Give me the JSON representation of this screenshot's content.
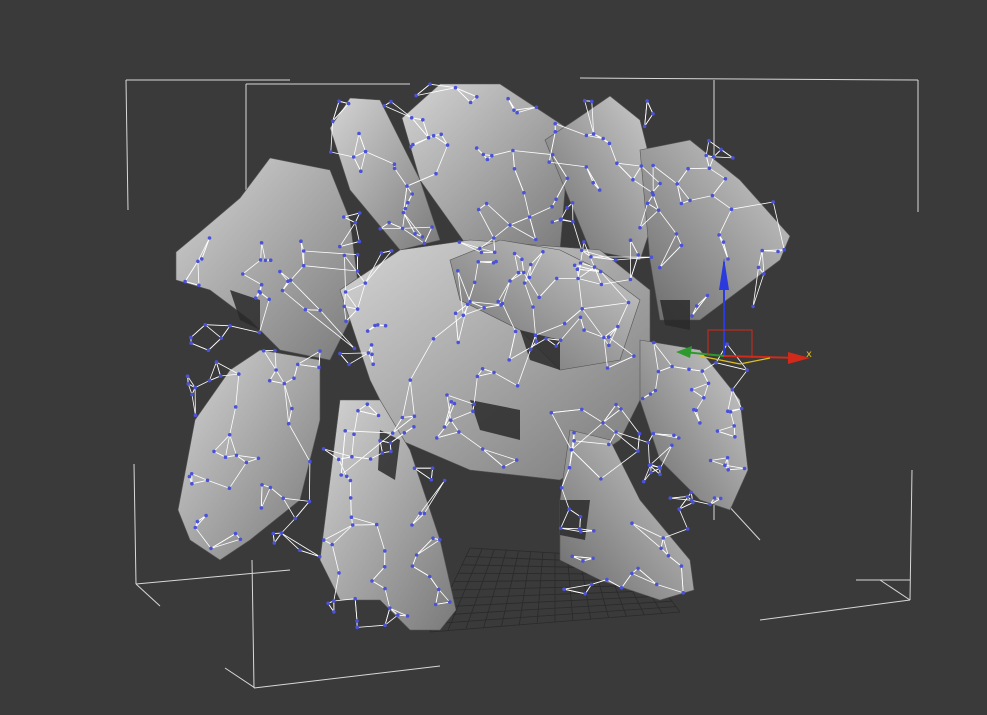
{
  "viewport": {
    "background": "#3a3a3a",
    "bbox_color": "#d8d8d8",
    "grid_color": "#2a2a2a"
  },
  "model": {
    "surface_colors": [
      "#6f6f6f",
      "#8a8a8a",
      "#a4a4a4",
      "#bdbdbd",
      "#d6d6d6"
    ],
    "edge_color": "#ffffff",
    "vertex_color": "#4a52d8"
  },
  "gizmo": {
    "x_label": "x",
    "x_color": "#d12a1a",
    "y_color": "#2e9a2e",
    "z_color": "#2a3adc",
    "plane_color": "#e0c020"
  }
}
